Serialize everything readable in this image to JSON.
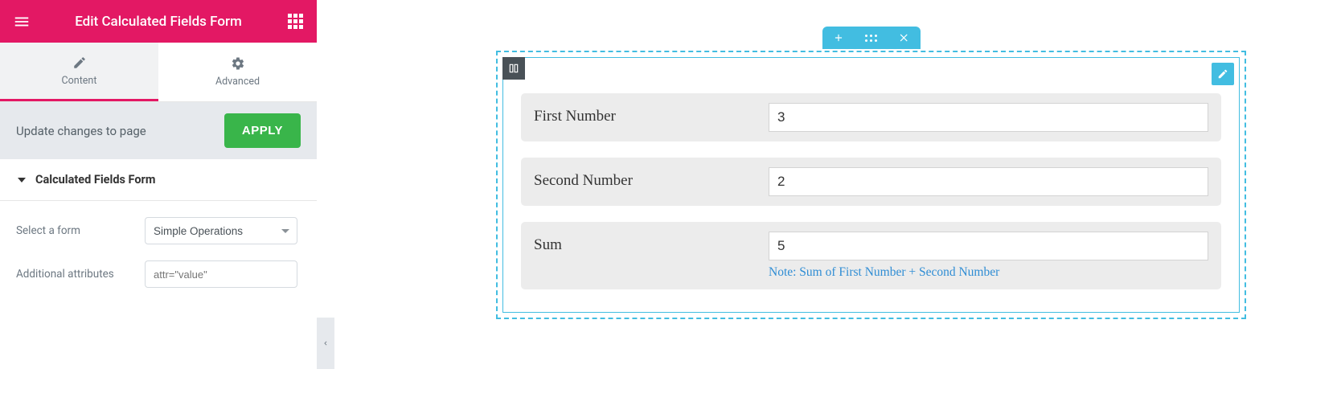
{
  "header": {
    "title": "Edit Calculated Fields Form"
  },
  "tabs": {
    "content": "Content",
    "advanced": "Advanced"
  },
  "apply": {
    "message": "Update changes to page",
    "button": "APPLY"
  },
  "section": {
    "title": "Calculated Fields Form"
  },
  "controls": {
    "select_label": "Select a form",
    "select_value": "Simple Operations",
    "attr_label": "Additional attributes",
    "attr_placeholder": "attr=\"value\""
  },
  "form": {
    "fields": [
      {
        "label": "First Number",
        "value": "3"
      },
      {
        "label": "Second Number",
        "value": "2"
      },
      {
        "label": "Sum",
        "value": "5",
        "note": "Note: Sum of First Number + Second Number"
      }
    ]
  }
}
